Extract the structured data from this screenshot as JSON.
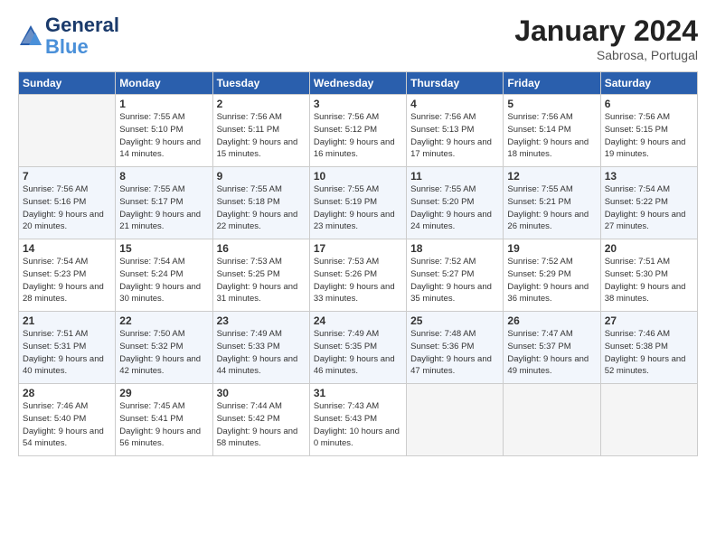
{
  "header": {
    "logo_line1": "General",
    "logo_line2": "Blue",
    "month": "January 2024",
    "location": "Sabrosa, Portugal"
  },
  "days_of_week": [
    "Sunday",
    "Monday",
    "Tuesday",
    "Wednesday",
    "Thursday",
    "Friday",
    "Saturday"
  ],
  "weeks": [
    [
      {
        "day": null
      },
      {
        "day": 1,
        "sunrise": "7:55 AM",
        "sunset": "5:10 PM",
        "daylight": "9 hours and 14 minutes."
      },
      {
        "day": 2,
        "sunrise": "7:56 AM",
        "sunset": "5:11 PM",
        "daylight": "9 hours and 15 minutes."
      },
      {
        "day": 3,
        "sunrise": "7:56 AM",
        "sunset": "5:12 PM",
        "daylight": "9 hours and 16 minutes."
      },
      {
        "day": 4,
        "sunrise": "7:56 AM",
        "sunset": "5:13 PM",
        "daylight": "9 hours and 17 minutes."
      },
      {
        "day": 5,
        "sunrise": "7:56 AM",
        "sunset": "5:14 PM",
        "daylight": "9 hours and 18 minutes."
      },
      {
        "day": 6,
        "sunrise": "7:56 AM",
        "sunset": "5:15 PM",
        "daylight": "9 hours and 19 minutes."
      }
    ],
    [
      {
        "day": 7,
        "sunrise": "7:56 AM",
        "sunset": "5:16 PM",
        "daylight": "9 hours and 20 minutes."
      },
      {
        "day": 8,
        "sunrise": "7:55 AM",
        "sunset": "5:17 PM",
        "daylight": "9 hours and 21 minutes."
      },
      {
        "day": 9,
        "sunrise": "7:55 AM",
        "sunset": "5:18 PM",
        "daylight": "9 hours and 22 minutes."
      },
      {
        "day": 10,
        "sunrise": "7:55 AM",
        "sunset": "5:19 PM",
        "daylight": "9 hours and 23 minutes."
      },
      {
        "day": 11,
        "sunrise": "7:55 AM",
        "sunset": "5:20 PM",
        "daylight": "9 hours and 24 minutes."
      },
      {
        "day": 12,
        "sunrise": "7:55 AM",
        "sunset": "5:21 PM",
        "daylight": "9 hours and 26 minutes."
      },
      {
        "day": 13,
        "sunrise": "7:54 AM",
        "sunset": "5:22 PM",
        "daylight": "9 hours and 27 minutes."
      }
    ],
    [
      {
        "day": 14,
        "sunrise": "7:54 AM",
        "sunset": "5:23 PM",
        "daylight": "9 hours and 28 minutes."
      },
      {
        "day": 15,
        "sunrise": "7:54 AM",
        "sunset": "5:24 PM",
        "daylight": "9 hours and 30 minutes."
      },
      {
        "day": 16,
        "sunrise": "7:53 AM",
        "sunset": "5:25 PM",
        "daylight": "9 hours and 31 minutes."
      },
      {
        "day": 17,
        "sunrise": "7:53 AM",
        "sunset": "5:26 PM",
        "daylight": "9 hours and 33 minutes."
      },
      {
        "day": 18,
        "sunrise": "7:52 AM",
        "sunset": "5:27 PM",
        "daylight": "9 hours and 35 minutes."
      },
      {
        "day": 19,
        "sunrise": "7:52 AM",
        "sunset": "5:29 PM",
        "daylight": "9 hours and 36 minutes."
      },
      {
        "day": 20,
        "sunrise": "7:51 AM",
        "sunset": "5:30 PM",
        "daylight": "9 hours and 38 minutes."
      }
    ],
    [
      {
        "day": 21,
        "sunrise": "7:51 AM",
        "sunset": "5:31 PM",
        "daylight": "9 hours and 40 minutes."
      },
      {
        "day": 22,
        "sunrise": "7:50 AM",
        "sunset": "5:32 PM",
        "daylight": "9 hours and 42 minutes."
      },
      {
        "day": 23,
        "sunrise": "7:49 AM",
        "sunset": "5:33 PM",
        "daylight": "9 hours and 44 minutes."
      },
      {
        "day": 24,
        "sunrise": "7:49 AM",
        "sunset": "5:35 PM",
        "daylight": "9 hours and 46 minutes."
      },
      {
        "day": 25,
        "sunrise": "7:48 AM",
        "sunset": "5:36 PM",
        "daylight": "9 hours and 47 minutes."
      },
      {
        "day": 26,
        "sunrise": "7:47 AM",
        "sunset": "5:37 PM",
        "daylight": "9 hours and 49 minutes."
      },
      {
        "day": 27,
        "sunrise": "7:46 AM",
        "sunset": "5:38 PM",
        "daylight": "9 hours and 52 minutes."
      }
    ],
    [
      {
        "day": 28,
        "sunrise": "7:46 AM",
        "sunset": "5:40 PM",
        "daylight": "9 hours and 54 minutes."
      },
      {
        "day": 29,
        "sunrise": "7:45 AM",
        "sunset": "5:41 PM",
        "daylight": "9 hours and 56 minutes."
      },
      {
        "day": 30,
        "sunrise": "7:44 AM",
        "sunset": "5:42 PM",
        "daylight": "9 hours and 58 minutes."
      },
      {
        "day": 31,
        "sunrise": "7:43 AM",
        "sunset": "5:43 PM",
        "daylight": "10 hours and 0 minutes."
      },
      {
        "day": null
      },
      {
        "day": null
      },
      {
        "day": null
      }
    ]
  ]
}
